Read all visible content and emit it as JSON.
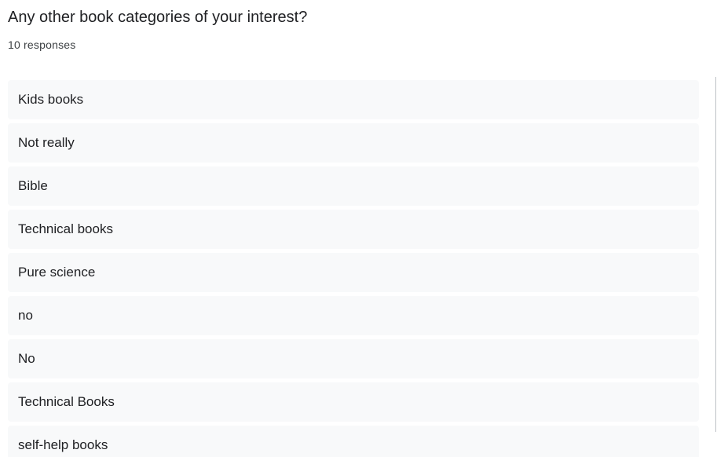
{
  "question": {
    "title": "Any other book categories of your interest?",
    "response_count": "10 responses"
  },
  "responses": [
    "Kids books",
    "Not really",
    "Bible",
    "Technical books",
    "Pure science",
    "no",
    "No",
    "Technical Books",
    "self-help books"
  ]
}
